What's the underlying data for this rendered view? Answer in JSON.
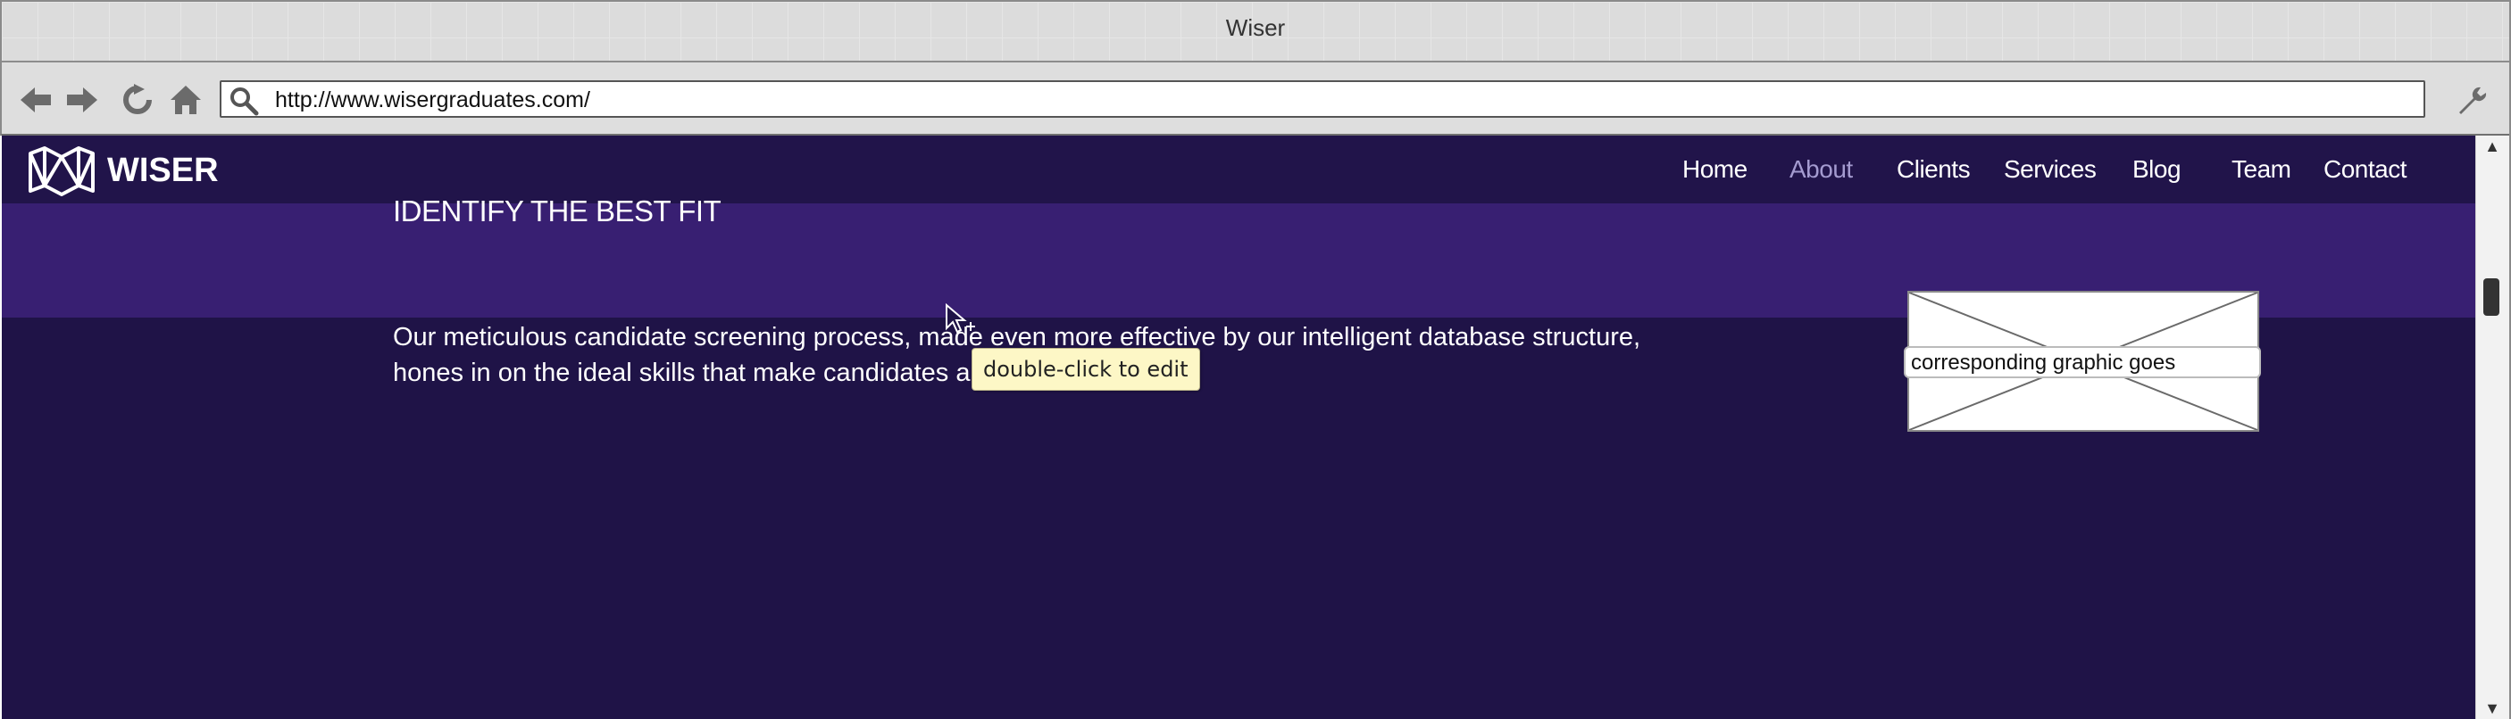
{
  "window": {
    "title": "Wiser"
  },
  "toolbar": {
    "back_icon": "back-arrow-icon",
    "forward_icon": "forward-arrow-icon",
    "reload_icon": "reload-icon",
    "home_icon": "home-icon",
    "search_icon": "search-icon",
    "url": "http://www.wisergraduates.com/",
    "settings_icon": "wrench-icon"
  },
  "site": {
    "logo_text": "WISER",
    "nav": [
      "Home",
      "About",
      "Clients",
      "Services",
      "Blog",
      "Team",
      "Contact"
    ],
    "active_nav": "About",
    "colors": {
      "nav_bg": "#21144a",
      "band_bg": "#381f72",
      "section_bg": "#1f1347",
      "active_link": "#a49bd0",
      "text": "#ffffff"
    }
  },
  "section": {
    "heading": "IDENTIFY THE BEST FIT",
    "body": "Our meticulous candidate screening process, made even more effective by our intelligent database structure, hones in on the ideal skills that make candidates a great fit for you.",
    "image_placeholder_label": "corresponding graphic goes"
  },
  "tooltip": {
    "text": "double-click to edit"
  }
}
